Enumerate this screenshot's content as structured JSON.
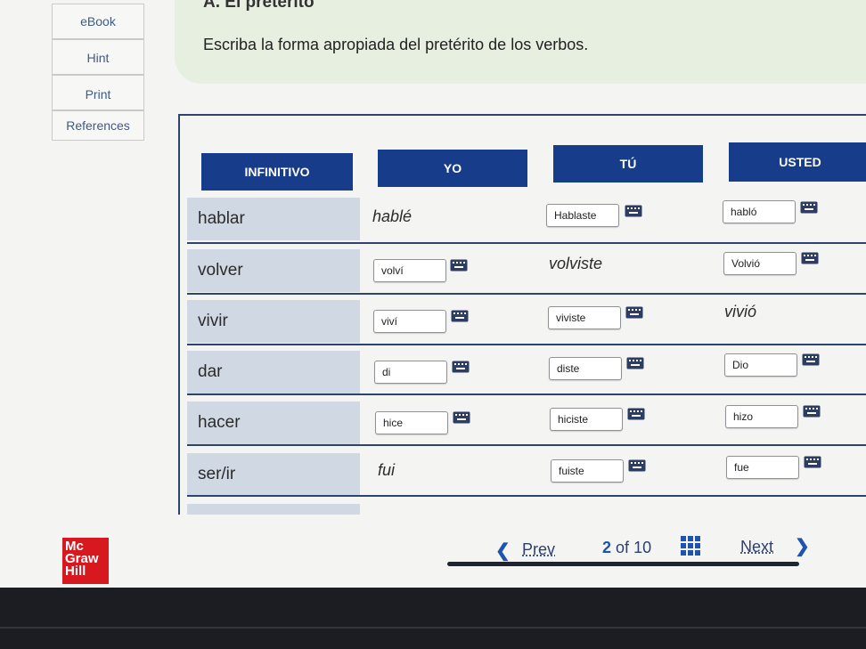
{
  "sidenav": {
    "ebook": "eBook",
    "hint": "Hint",
    "print": "Print",
    "references": "References"
  },
  "header": {
    "section_title": "A. El pretérito",
    "instruction": "Escriba la forma apropiada del pretérito de los verbos."
  },
  "table": {
    "columns": [
      "INFINITIVO",
      "YO",
      "TÚ",
      "USTED"
    ],
    "rows": [
      {
        "infinitivo": "hablar",
        "yo": "hablé",
        "tu": "Hablaste",
        "usted": "habló"
      },
      {
        "infinitivo": "volver",
        "yo": "volví",
        "tu": "volviste",
        "usted": "Volvió"
      },
      {
        "infinitivo": "vivir",
        "yo": "viví",
        "tu": "viviste",
        "usted": "vivió"
      },
      {
        "infinitivo": "dar",
        "yo": "di",
        "tu": "diste",
        "usted": "Dio"
      },
      {
        "infinitivo": "hacer",
        "yo": "hice",
        "tu": "hiciste",
        "usted": "hizo"
      },
      {
        "infinitivo": "ser/ir",
        "yo": "fui",
        "tu": "fuiste",
        "usted": "fue"
      }
    ]
  },
  "footer": {
    "logo_lines": [
      "Mc",
      "Graw",
      "Hill"
    ],
    "prev": "Prev",
    "current_page": "2",
    "of_label": "of",
    "total_pages": "10",
    "next": "Next"
  },
  "colors": {
    "header_blue": "#173c8a",
    "infinitive_cell": "#d0d9e3",
    "instruction_bg": "#e7efe1",
    "logo_red": "#d7181f"
  }
}
